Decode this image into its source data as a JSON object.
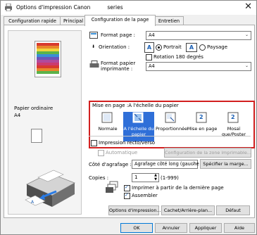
{
  "window": {
    "title": "Options d'impression Canon",
    "title_suffix": "series",
    "close_glyph": "✕"
  },
  "tabs": [
    {
      "label": "Configuration rapide"
    },
    {
      "label": "Principal"
    },
    {
      "label": "Configuration de la page",
      "active": true
    },
    {
      "label": "Entretien"
    }
  ],
  "preview": {
    "media_type": "Papier ordinaire",
    "paper_size": "A4"
  },
  "page_setup": {
    "format_label": "Format page :",
    "format_value": "A4",
    "orientation_label": "Orientation :",
    "portrait_label": "Portrait",
    "paysage_label": "Paysage",
    "orientation_selected": "Portrait",
    "rotation_label": "Rotation 180 degrés",
    "rotation_checked": false,
    "printer_paper_label_1": "Format papier",
    "printer_paper_label_2": "imprimante :",
    "printer_paper_value": "A4"
  },
  "layout": {
    "title": "Mise en page :A l'échelle du papier",
    "items": [
      {
        "label": "Normale",
        "icon": "normal-icon"
      },
      {
        "label": "A l'échelle du papier",
        "icon": "fit-to-paper-icon",
        "selected": true
      },
      {
        "label": "Proportionnée",
        "icon": "scaled-icon"
      },
      {
        "label": "Mise en page",
        "icon": "page-layout-icon",
        "badge": "2"
      },
      {
        "label": "Mosaï que/Poster",
        "icon": "tiling-poster-icon",
        "badge": "2"
      }
    ]
  },
  "duplex": {
    "label": "Impression recto/verso",
    "checked": false,
    "auto_label": "Automatique",
    "auto_checked": false,
    "area_button": "Configuration de la zone imprimable..."
  },
  "stapling": {
    "label": "Côté d'agrafage :",
    "value": "Agrafage côté long (gauche",
    "margin_button": "Spécifier la marge..."
  },
  "copies": {
    "label": "Copies :",
    "value": "1",
    "range": "(1-999)",
    "last_page_label": "Imprimer à partir de la dernière page",
    "last_page_checked": true,
    "collate_label": "Assembler",
    "collate_checked": true
  },
  "panel_buttons": {
    "options": "Options d'impression...",
    "stamp": "Cachet/Arrière-plan...",
    "default": "Défaut"
  },
  "dialog_buttons": {
    "ok": "OK",
    "cancel": "Annuler",
    "apply": "Appliquer",
    "help": "Aide"
  },
  "colors": {
    "selected": "#2f6fd8",
    "highlight_border": "#d21f1f"
  }
}
